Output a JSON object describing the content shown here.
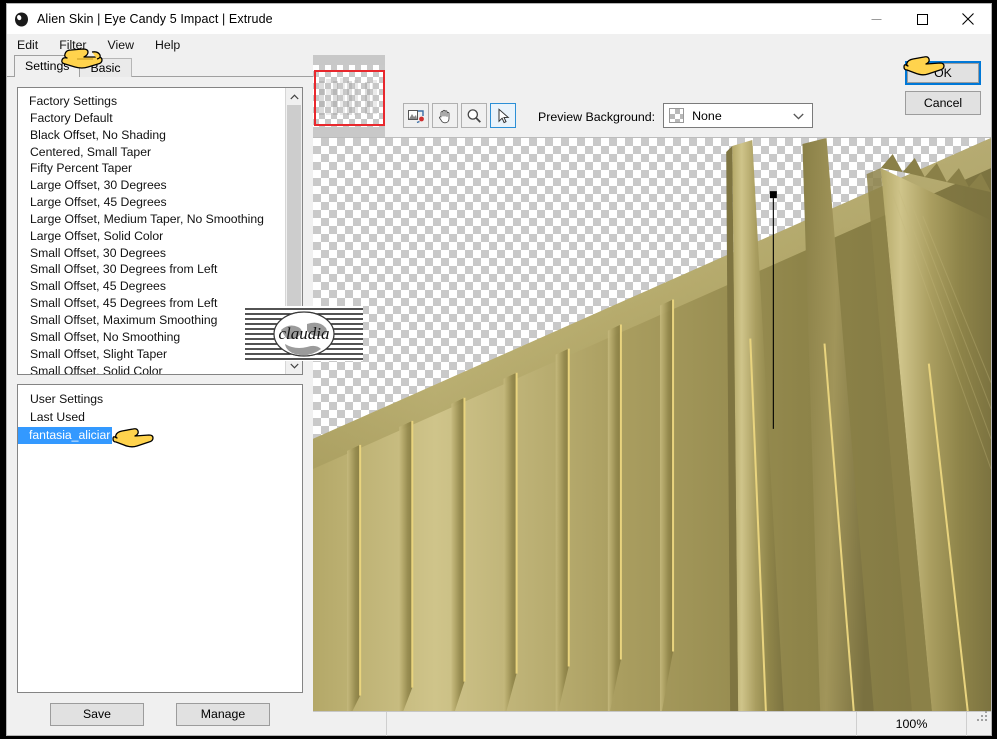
{
  "window": {
    "title": "Alien Skin | Eye Candy 5 Impact | Extrude",
    "icon": "alien-skin-logo-icon",
    "controls": {
      "minimize": "minimize-icon",
      "maximize": "maximize-icon",
      "close": "close-icon"
    }
  },
  "menu": {
    "items": [
      {
        "label": "Edit"
      },
      {
        "label": "Filter"
      },
      {
        "label": "View"
      },
      {
        "label": "Help"
      }
    ]
  },
  "tabs": [
    {
      "label": "Settings",
      "active": true
    },
    {
      "label": "Basic",
      "active": false
    }
  ],
  "factory_settings": {
    "group_label": "Factory Settings",
    "items": [
      "Factory Default",
      "Black Offset, No Shading",
      "Centered, Small Taper",
      "Fifty Percent Taper",
      "Large Offset, 30 Degrees",
      "Large Offset, 45 Degrees",
      "Large Offset, Medium Taper, No Smoothing",
      "Large Offset, Solid Color",
      "Small Offset, 30 Degrees",
      "Small Offset, 30 Degrees from Left",
      "Small Offset, 45 Degrees",
      "Small Offset, 45 Degrees from Left",
      "Small Offset, Maximum Smoothing",
      "Small Offset, No Smoothing",
      "Small Offset, Slight Taper",
      "Small Offset, Solid Color"
    ],
    "scroll_up_icon": "chevron-up-icon",
    "scroll_down_icon": "chevron-down-icon"
  },
  "user_settings": {
    "group_label": "User Settings",
    "items": [
      {
        "label": "Last Used",
        "selected": false
      },
      {
        "label": "fantasia_aliciar",
        "selected": true
      }
    ]
  },
  "left_buttons": {
    "save": "Save",
    "manage": "Manage"
  },
  "preview_toolbar": {
    "tools": [
      {
        "name": "compare-before-after-icon",
        "active": false
      },
      {
        "name": "hand-pan-icon",
        "active": false
      },
      {
        "name": "zoom-magnifier-icon",
        "active": false
      },
      {
        "name": "arrow-select-icon",
        "active": true
      }
    ],
    "background_label": "Preview Background:",
    "background_value": "None",
    "background_swatch": "transparent-checker-swatch",
    "chevron": "chevron-down-icon"
  },
  "dialog_buttons": {
    "ok": "OK",
    "cancel": "Cancel"
  },
  "status_bar": {
    "zoom": "100%",
    "grip": "resize-grip-icon"
  },
  "watermark": {
    "text": "claudia"
  },
  "colors": {
    "accent_blue": "#0078d7",
    "selection_blue": "#3399ff",
    "viewport_red": "#e8282d",
    "gold_light": "#cfc488",
    "gold_mid": "#a89a5c",
    "gold_dark": "#7d7340",
    "gold_edge": "#e8d27a",
    "window_bg": "#f0f0f0"
  },
  "cursors": [
    {
      "name": "hand-pointer-cursor-filter-menu"
    },
    {
      "name": "hand-pointer-cursor-user-setting"
    },
    {
      "name": "hand-pointer-cursor-ok-button"
    }
  ]
}
